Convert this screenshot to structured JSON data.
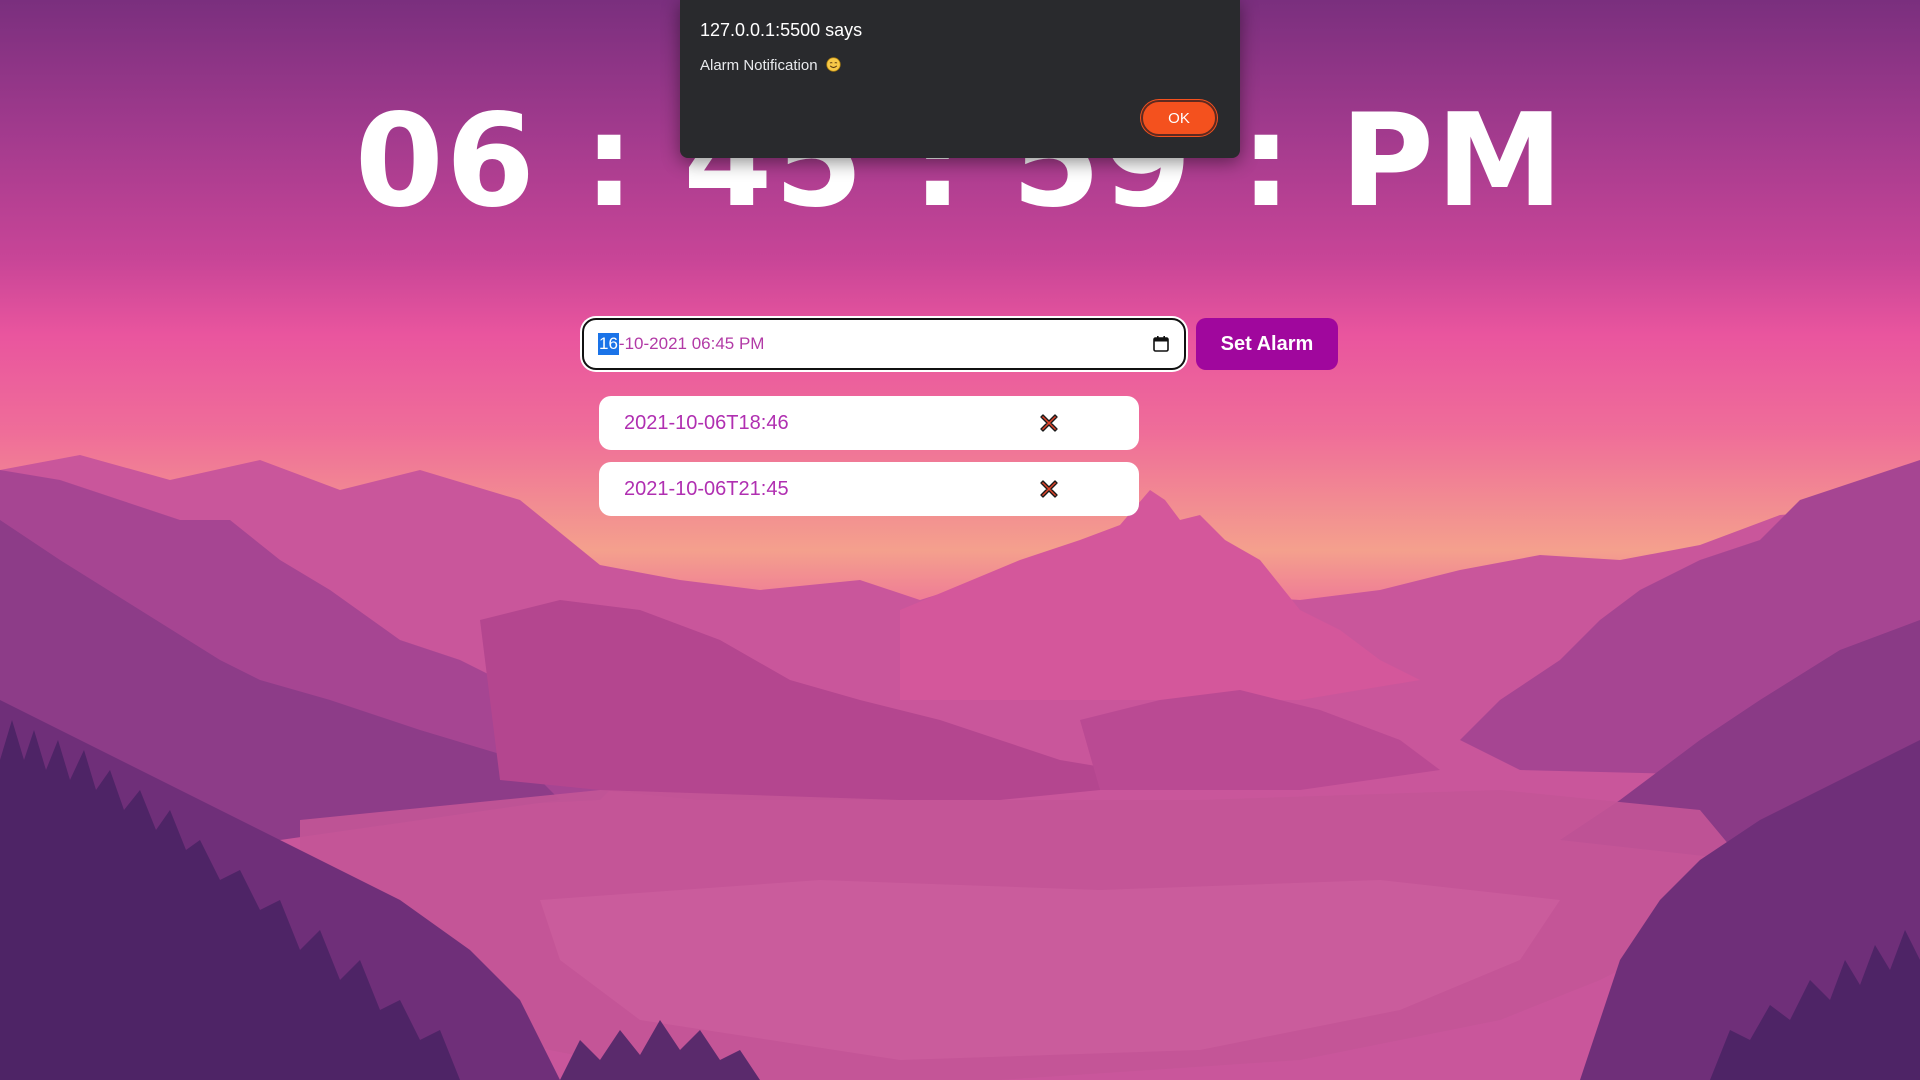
{
  "clock": {
    "display": "06 : 45 : 59 : PM"
  },
  "alarm_form": {
    "datetime_value_day": "16",
    "datetime_value_rest": "-10-2021 06:45 PM",
    "set_button_label": "Set Alarm"
  },
  "alarms": [
    {
      "time": "2021-10-06T18:46"
    },
    {
      "time": "2021-10-06T21:45"
    }
  ],
  "dialog": {
    "title": "127.0.0.1:5500 says",
    "message": "Alarm Notification",
    "ok_label": "OK"
  },
  "colors": {
    "accent": "#a0079d",
    "alarm_text": "#b02fb1",
    "dialog_bg": "#292a2d",
    "ok_button": "#f4511e"
  },
  "icons": {
    "calendar": "calendar-icon",
    "delete": "delete-x-icon",
    "emoji": "smiling-face-icon"
  }
}
